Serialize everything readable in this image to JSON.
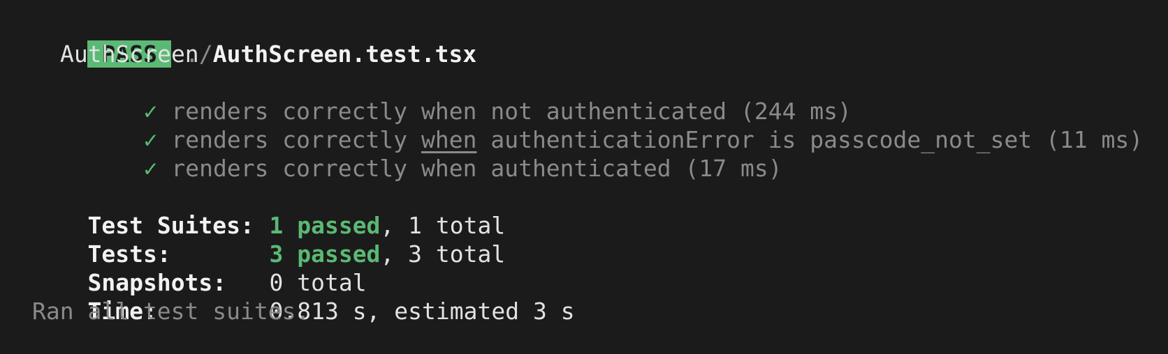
{
  "header": {
    "status_badge": "PASS",
    "file_path_prefix": "./",
    "file_name": "AuthScreen.test.tsx"
  },
  "suite": {
    "name": "AuthScreen",
    "tests": [
      {
        "check": "✓",
        "title_prefix": "renders correctly ",
        "title_keyword": "when",
        "title_suffix": " not authenticated",
        "duration": "(244 ms)"
      },
      {
        "check": "✓",
        "title_prefix": "renders correctly ",
        "title_keyword": "when",
        "title_suffix": " authenticationError is passcode_not_set",
        "duration": "(11 ms)"
      },
      {
        "check": "✓",
        "title_prefix": "renders correctly ",
        "title_keyword": "when",
        "title_suffix": " authenticated",
        "duration": "(17 ms)"
      }
    ]
  },
  "summary": {
    "test_suites_label": "Test Suites:",
    "test_suites_passed": "1 passed",
    "test_suites_total": ", 1 total",
    "tests_label": "Tests:",
    "tests_passed": "3 passed",
    "tests_total": ", 3 total",
    "snapshots_label": "Snapshots:",
    "snapshots_value": "0 total",
    "time_label": "Time:",
    "time_value": "0.813 s, estimated 3 s",
    "footer": "Ran all test suites."
  },
  "colors": {
    "background": "#1b1b1b",
    "pass_green": "#5ab974",
    "dim_text": "#8a8a8a",
    "bright_text": "#e2e2e2"
  }
}
